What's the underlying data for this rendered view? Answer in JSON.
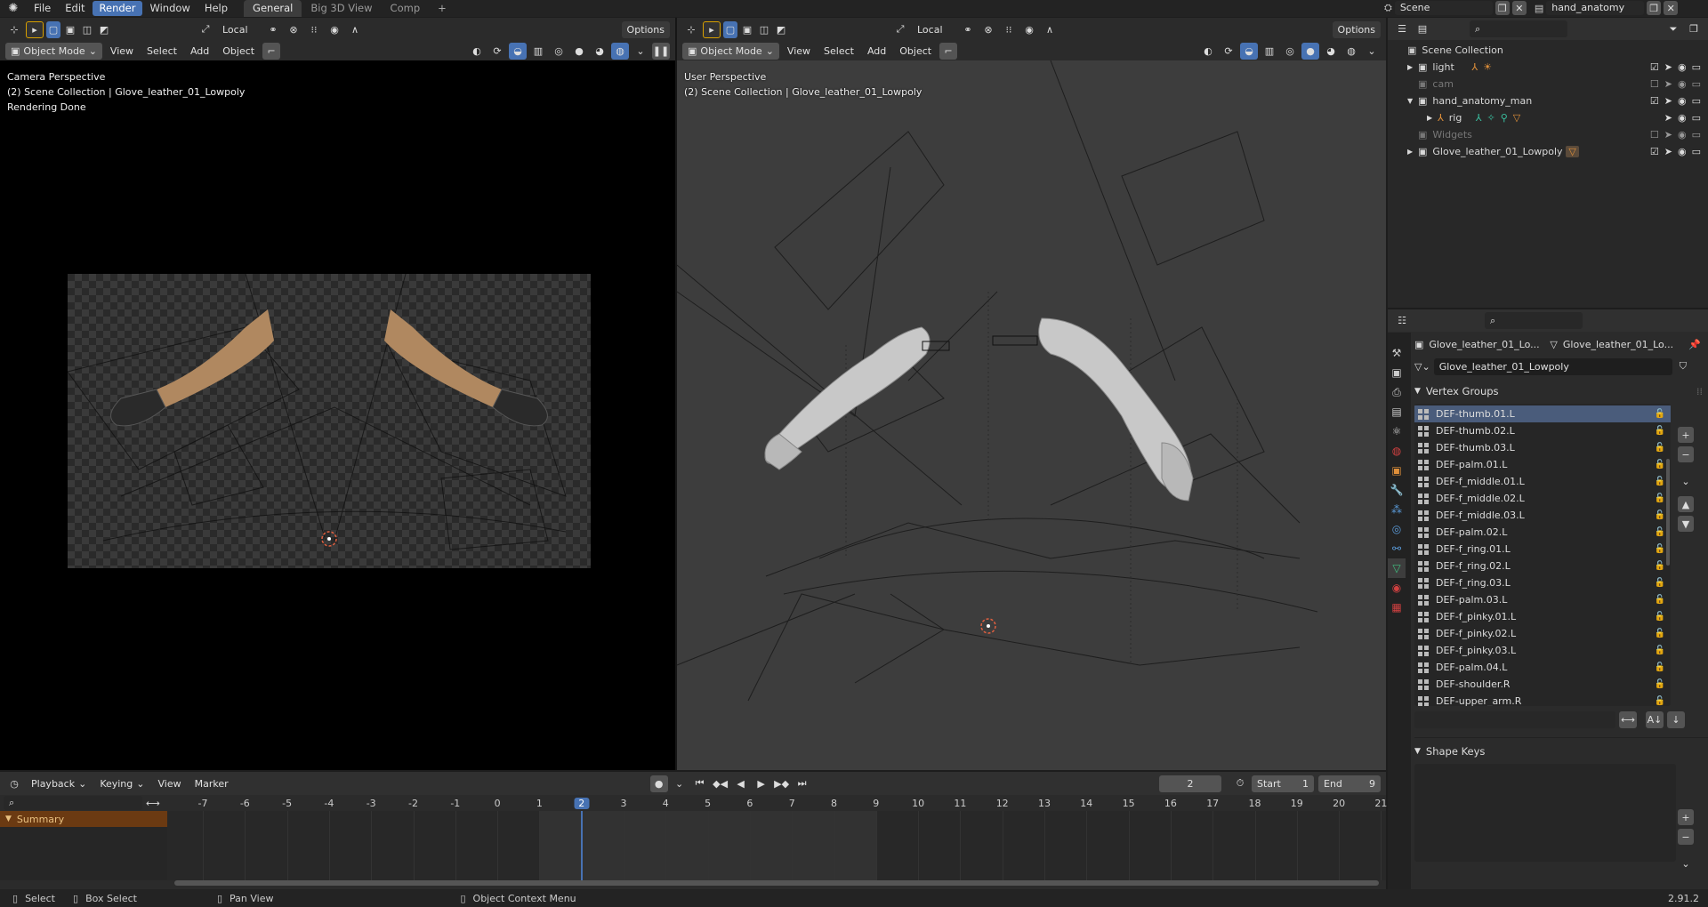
{
  "menu": {
    "items": [
      "File",
      "Edit",
      "Render",
      "Window",
      "Help"
    ],
    "active": "Render",
    "workspaces": [
      "General",
      "Big 3D View",
      "Comp"
    ],
    "active_workspace": "General",
    "add_tab": "+"
  },
  "scene": {
    "name": "Scene",
    "view_layer": "hand_anatomy"
  },
  "viewport_left": {
    "mode": "Object Mode",
    "menus": [
      "View",
      "Select",
      "Add",
      "Object"
    ],
    "transform": "Local",
    "options": "Options",
    "overlay_lines": [
      "Camera Perspective",
      "(2) Scene Collection | Glove_leather_01_Lowpoly",
      "Rendering Done"
    ]
  },
  "viewport_right": {
    "mode": "Object Mode",
    "menus": [
      "View",
      "Select",
      "Add",
      "Object"
    ],
    "transform": "Local",
    "options": "Options",
    "overlay_lines": [
      "User Perspective",
      "(2) Scene Collection | Glove_leather_01_Lowpoly"
    ]
  },
  "outliner": {
    "root": "Scene Collection",
    "rows": [
      {
        "label": "light",
        "indent": 1,
        "dim": false
      },
      {
        "label": "cam",
        "indent": 1,
        "dim": true
      },
      {
        "label": "hand_anatomy_man",
        "indent": 1,
        "dim": false
      },
      {
        "label": "rig",
        "indent": 2,
        "dim": false
      },
      {
        "label": "Widgets",
        "indent": 1,
        "dim": true
      },
      {
        "label": "Glove_leather_01_Lowpoly",
        "indent": 1,
        "dim": false
      }
    ]
  },
  "properties": {
    "object_name": "Glove_leather_01_Lo...",
    "mesh_name": "Glove_leather_01_Lo...",
    "data_field": "Glove_leather_01_Lowpoly",
    "vertex_groups_title": "Vertex Groups",
    "shape_keys_title": "Shape Keys",
    "vertex_groups": [
      "DEF-thumb.01.L",
      "DEF-thumb.02.L",
      "DEF-thumb.03.L",
      "DEF-palm.01.L",
      "DEF-f_middle.01.L",
      "DEF-f_middle.02.L",
      "DEF-f_middle.03.L",
      "DEF-palm.02.L",
      "DEF-f_ring.01.L",
      "DEF-f_ring.02.L",
      "DEF-f_ring.03.L",
      "DEF-palm.03.L",
      "DEF-f_pinky.01.L",
      "DEF-f_pinky.02.L",
      "DEF-f_pinky.03.L",
      "DEF-palm.04.L",
      "DEF-shoulder.R",
      "DEF-upper_arm.R"
    ],
    "selected_index": 0
  },
  "timeline": {
    "menus": [
      "Playback",
      "Keying",
      "View",
      "Marker"
    ],
    "current_frame": "2",
    "start_label": "Start",
    "start": "1",
    "end_label": "End",
    "end": "9",
    "ticks": [
      "-7",
      "-6",
      "-5",
      "-4",
      "-3",
      "-2",
      "-1",
      "0",
      "1",
      "2",
      "3",
      "4",
      "5",
      "6",
      "7",
      "8",
      "9",
      "10",
      "11",
      "12",
      "13",
      "14",
      "15",
      "16",
      "17",
      "18",
      "19",
      "20",
      "21"
    ],
    "summary": "Summary"
  },
  "statusbar": {
    "select": "Select",
    "box_select": "Box Select",
    "pan_view": "Pan View",
    "context_menu": "Object Context Menu",
    "version": "2.91.2"
  },
  "colors": {
    "accent": "#4772b3",
    "selected_row": "#4a5c7b",
    "summary": "#6b3a12",
    "frame_range": "#3a3a3a"
  }
}
